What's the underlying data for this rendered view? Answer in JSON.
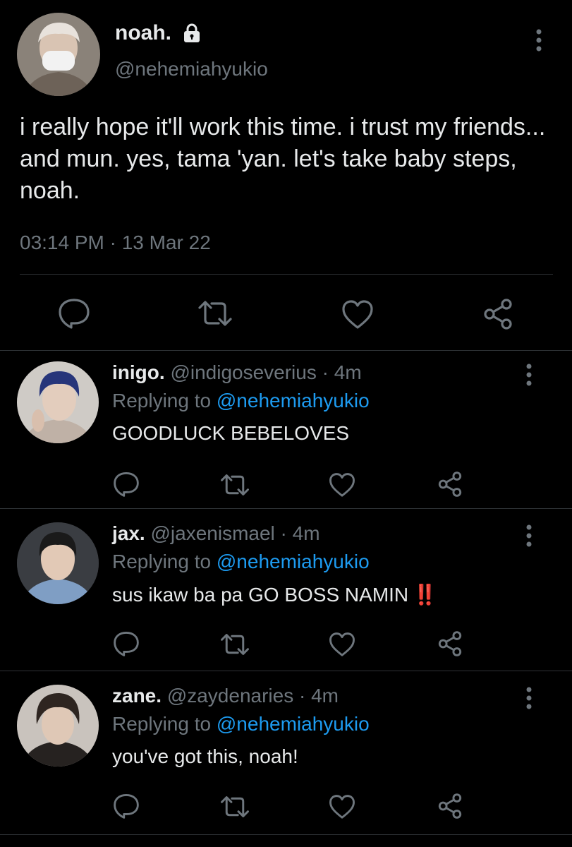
{
  "main": {
    "name": "noah.",
    "handle": "@nehemiahyukio",
    "text": "i really hope it'll work this time. i trust my friends... and mun. yes, tama 'yan. let's take baby steps, noah.",
    "timestamp": "03:14 PM · 13 Mar 22",
    "icons": [
      "lock-icon",
      "more-icon",
      "reply-icon",
      "retweet-icon",
      "like-icon",
      "share-icon"
    ]
  },
  "replies": [
    {
      "name": "inigo.",
      "handle": "@indigoseverius",
      "time": "· 4m",
      "replying_label": "Replying to",
      "mention": "@nehemiahyukio",
      "text": "GOODLUCK BEBELOVES"
    },
    {
      "name": "jax.",
      "handle": "@jaxenismael",
      "time": "· 4m",
      "replying_label": "Replying to",
      "mention": "@nehemiahyukio",
      "text": "sus ikaw ba pa GO BOSS NAMIN",
      "emoji": "‼️"
    },
    {
      "name": "zane.",
      "handle": "@zaydenaries",
      "time": "· 4m",
      "replying_label": "Replying to",
      "mention": "@nehemiahyukio",
      "text": "you've got this, noah!"
    }
  ],
  "colors": {
    "background": "#000000",
    "text": "#e7e9ea",
    "secondary": "#6e767d",
    "link": "#1d9bf0",
    "divider": "#2f3336"
  }
}
